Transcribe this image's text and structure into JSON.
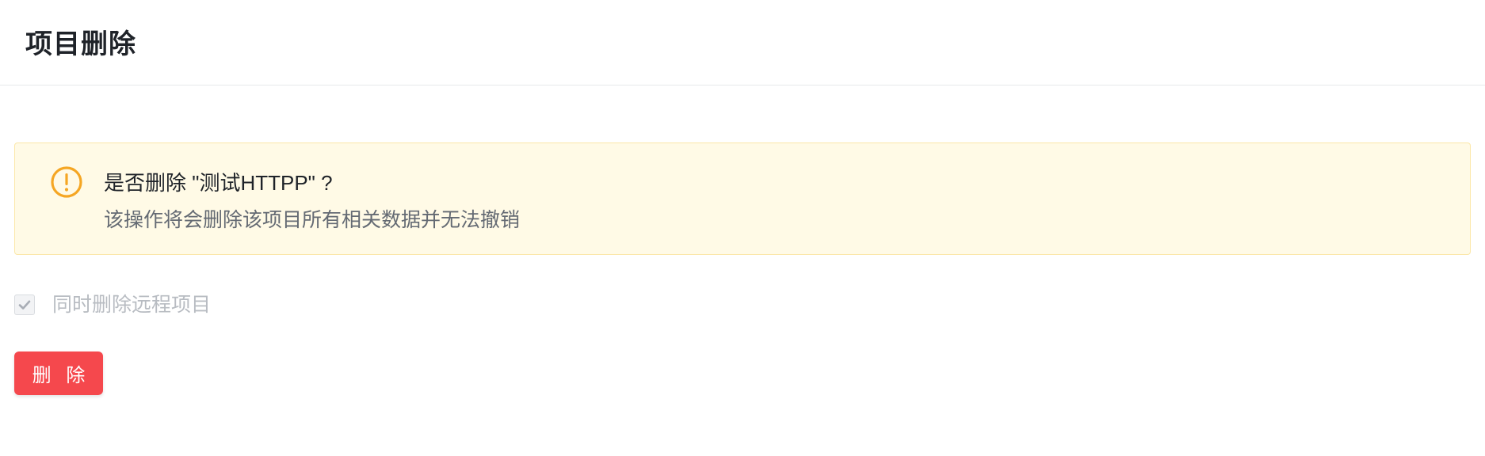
{
  "header": {
    "title": "项目删除"
  },
  "alert": {
    "icon": "exclamation-circle-icon",
    "title": "是否删除 \"测试HTTPP\" ?",
    "description": "该操作将会删除该项目所有相关数据并无法撤销",
    "colors": {
      "background": "#fffae6",
      "border": "#fbe7a8",
      "icon": "#f5a623"
    }
  },
  "options": {
    "delete_remote": {
      "label": "同时删除远程项目",
      "checked": true,
      "disabled": true
    }
  },
  "actions": {
    "delete_label": "删 除",
    "delete_color": "#f5484d"
  }
}
